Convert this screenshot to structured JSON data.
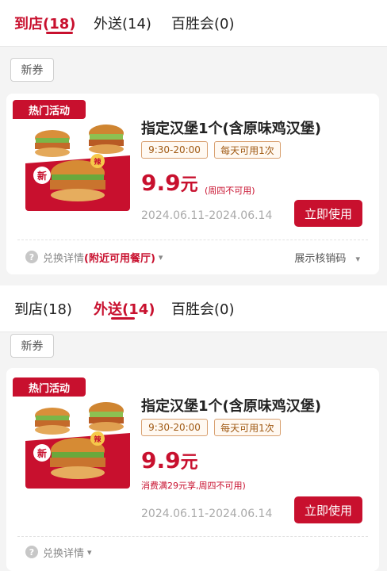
{
  "colors": {
    "accent": "#c8102e",
    "tag_border": "#d8a070",
    "tag_text": "#a05a14"
  },
  "sections": [
    {
      "tabs": [
        {
          "label": "到店(18)",
          "active": true
        },
        {
          "label": "外送(14)",
          "active": false
        },
        {
          "label": "百胜会(0)",
          "active": false
        }
      ],
      "filter_label": "新券",
      "coupon": {
        "badge": "热门活动",
        "title": "指定汉堡1个(含原味鸡汉堡)",
        "time_tag": "9:30-20:00",
        "limit_tag": "每天可用1次",
        "price": "9.9",
        "price_unit": "元",
        "note": "(周四不可用)",
        "dates": "2024.06.11-2024.06.14",
        "button": "立即使用",
        "details_label": "兑换详情",
        "details_extra": "(附近可用餐厅)",
        "verify_label": "展示核销码",
        "img_new": "新",
        "img_spicy": "辣",
        "icons": [
          "question-icon",
          "chevron-down-icon"
        ]
      }
    },
    {
      "tabs": [
        {
          "label": "到店(18)",
          "active": false
        },
        {
          "label": "外送(14)",
          "active": true
        },
        {
          "label": "百胜会(0)",
          "active": false
        }
      ],
      "filter_label": "新券",
      "coupon": {
        "badge": "热门活动",
        "title": "指定汉堡1个(含原味鸡汉堡)",
        "time_tag": "9:30-20:00",
        "limit_tag": "每天可用1次",
        "price": "9.9",
        "price_unit": "元",
        "note": "消费满29元享,周四不可用)",
        "dates": "2024.06.11-2024.06.14",
        "button": "立即使用",
        "details_label": "兑换详情",
        "img_new": "新",
        "img_spicy": "辣",
        "icons": [
          "question-icon",
          "chevron-down-icon"
        ]
      }
    }
  ]
}
